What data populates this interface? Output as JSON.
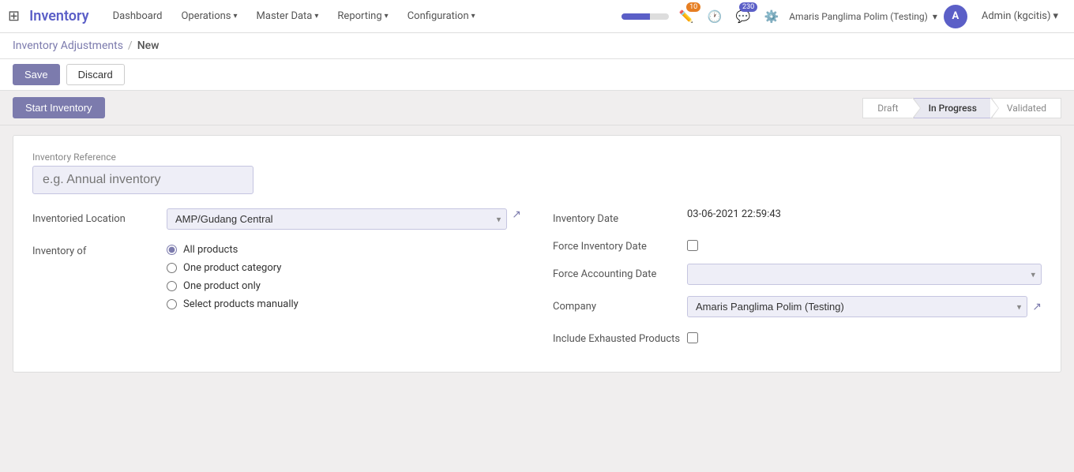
{
  "navbar": {
    "brand": "Inventory",
    "nav_items": [
      {
        "label": "Dashboard",
        "has_arrow": false
      },
      {
        "label": "Operations",
        "has_arrow": true
      },
      {
        "label": "Master Data",
        "has_arrow": true
      },
      {
        "label": "Reporting",
        "has_arrow": true
      },
      {
        "label": "Configuration",
        "has_arrow": true
      }
    ],
    "badge_edit": "10",
    "badge_chat": "230",
    "user_name": "Amaris Panglima Polim (Testing)",
    "admin_label": "Admin (kgcitis)",
    "avatar_initials": "A"
  },
  "breadcrumb": {
    "parent": "Inventory Adjustments",
    "separator": "/",
    "current": "New"
  },
  "actions": {
    "save_label": "Save",
    "discard_label": "Discard"
  },
  "toolbar": {
    "start_inventory_label": "Start Inventory"
  },
  "status_steps": [
    {
      "label": "Draft",
      "active": false
    },
    {
      "label": "In Progress",
      "active": true
    },
    {
      "label": "Validated",
      "active": false
    }
  ],
  "form": {
    "inventory_reference_label": "Inventory Reference",
    "inventory_reference_placeholder": "e.g. Annual inventory",
    "inventoried_location_label": "Inventoried Location",
    "inventoried_location_value": "AMP/Gudang Central",
    "inventory_of_label": "Inventory of",
    "radio_options": [
      {
        "id": "all_products",
        "label": "All products",
        "checked": true
      },
      {
        "id": "one_category",
        "label": "One product category",
        "checked": false
      },
      {
        "id": "one_product",
        "label": "One product only",
        "checked": false
      },
      {
        "id": "manually",
        "label": "Select products manually",
        "checked": false
      }
    ],
    "inventory_date_label": "Inventory Date",
    "inventory_date_value": "03-06-2021 22:59:43",
    "force_inventory_date_label": "Force Inventory Date",
    "force_accounting_date_label": "Force Accounting Date",
    "company_label": "Company",
    "company_value": "Amaris Panglima Polim (Testing)",
    "include_exhausted_label": "Include Exhausted Products"
  }
}
